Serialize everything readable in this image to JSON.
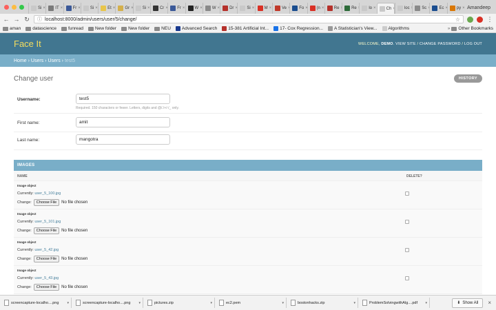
{
  "browser": {
    "traffic_colors": [
      "#fc605c",
      "#fdbc40",
      "#34c84a"
    ],
    "tabs": [
      {
        "label": "Si",
        "fav": "#c9c9c9"
      },
      {
        "label": "IT",
        "fav": "#7a7a7a"
      },
      {
        "label": "Fr",
        "fav": "#3b5998"
      },
      {
        "label": "Si",
        "fav": "#c9c9c9"
      },
      {
        "label": "Et",
        "fav": "#e8c54a"
      },
      {
        "label": "Gr",
        "fav": "#d4b04c"
      },
      {
        "label": "Si",
        "fav": "#c9c9c9"
      },
      {
        "label": "Cr",
        "fav": "#333333"
      },
      {
        "label": "Fr",
        "fav": "#3b5998"
      },
      {
        "label": "W",
        "fav": "#222222"
      },
      {
        "label": "W",
        "fav": "#8a8a8a"
      },
      {
        "label": "Dr",
        "fav": "#b5312b"
      },
      {
        "label": "Si",
        "fav": "#c9c9c9"
      },
      {
        "label": "M",
        "fav": "#d93025"
      },
      {
        "label": "Ve",
        "fav": "#c0392b"
      },
      {
        "label": "Fo",
        "fav": "#1a4d8f"
      },
      {
        "label": "(n",
        "fav": "#d93025"
      },
      {
        "label": "Re",
        "fav": "#b5312b"
      },
      {
        "label": "Re",
        "fav": "#2e6b3a"
      },
      {
        "label": "lo",
        "fav": "#c9c9c9"
      },
      {
        "label": "Ch",
        "fav": "#c9c9c9",
        "active": true
      },
      {
        "label": "loc",
        "fav": "#c9c9c9"
      },
      {
        "label": "Sc",
        "fav": "#8a8a8a"
      },
      {
        "label": "Ec",
        "fav": "#1a4d8f"
      },
      {
        "label": "py",
        "fav": "#d97706"
      }
    ],
    "profile_name": "Amandeep",
    "url": "localhost:8000/admin/users/user/5/change/",
    "bookmarks": [
      {
        "label": "aman",
        "type": "folder"
      },
      {
        "label": "datascience",
        "type": "folder"
      },
      {
        "label": "funread",
        "type": "folder"
      },
      {
        "label": "New folder",
        "type": "folder"
      },
      {
        "label": "New folder",
        "type": "folder"
      },
      {
        "label": "NEU",
        "type": "folder"
      },
      {
        "label": "Advanced Search",
        "type": "link",
        "fav": "#1a3a8f"
      },
      {
        "label": "15-381 Artificial Int...",
        "type": "link",
        "fav": "#b5312b"
      },
      {
        "label": "17- Cox Regression...",
        "type": "link",
        "fav": "#1a73e8"
      },
      {
        "label": "A Statistician's View...",
        "type": "link",
        "fav": "#999999"
      },
      {
        "label": "Algorithms",
        "type": "link",
        "fav": "#cccccc"
      }
    ],
    "other_bookmarks": "Other Bookmarks"
  },
  "header": {
    "branding": "Face It",
    "welcome": "WELCOME,",
    "user": "DEMO",
    "view_site": "VIEW SITE",
    "change_password": "CHANGE PASSWORD",
    "logout": "LOG OUT"
  },
  "breadcrumbs": {
    "home": "Home",
    "app": "Users",
    "model": "Users",
    "current": "test5"
  },
  "page": {
    "title": "Change user",
    "history": "HISTORY"
  },
  "form": {
    "username_label": "Username:",
    "username_value": "test5",
    "username_help": "Required. 150 characters or fewer. Letters, digits and @/./+/-/_ only.",
    "first_name_label": "First name:",
    "first_name_value": "amit",
    "last_name_label": "Last name:",
    "last_name_value": "mangotra"
  },
  "images": {
    "heading": "IMAGES",
    "col_name": "NAME",
    "col_delete": "DELETE?",
    "object_label": "Image object",
    "currently_label": "Currently:",
    "change_label": "Change:",
    "choose_file": "Choose File",
    "no_file": "No file chosen",
    "rows": [
      {
        "file": "user_5_100.jpg"
      },
      {
        "file": "user_5_101.jpg"
      },
      {
        "file": "user_5_42.jpg"
      },
      {
        "file": "user_5_43.jpg"
      }
    ]
  },
  "downloads": {
    "items": [
      "screencapture-localho....png",
      "screencapture-localho....png",
      "pictures.zip",
      "ec2.pem",
      "bostonhacks.zip",
      "ProblemSolvingwithAlg....pdf"
    ],
    "show_all": "Show All"
  }
}
